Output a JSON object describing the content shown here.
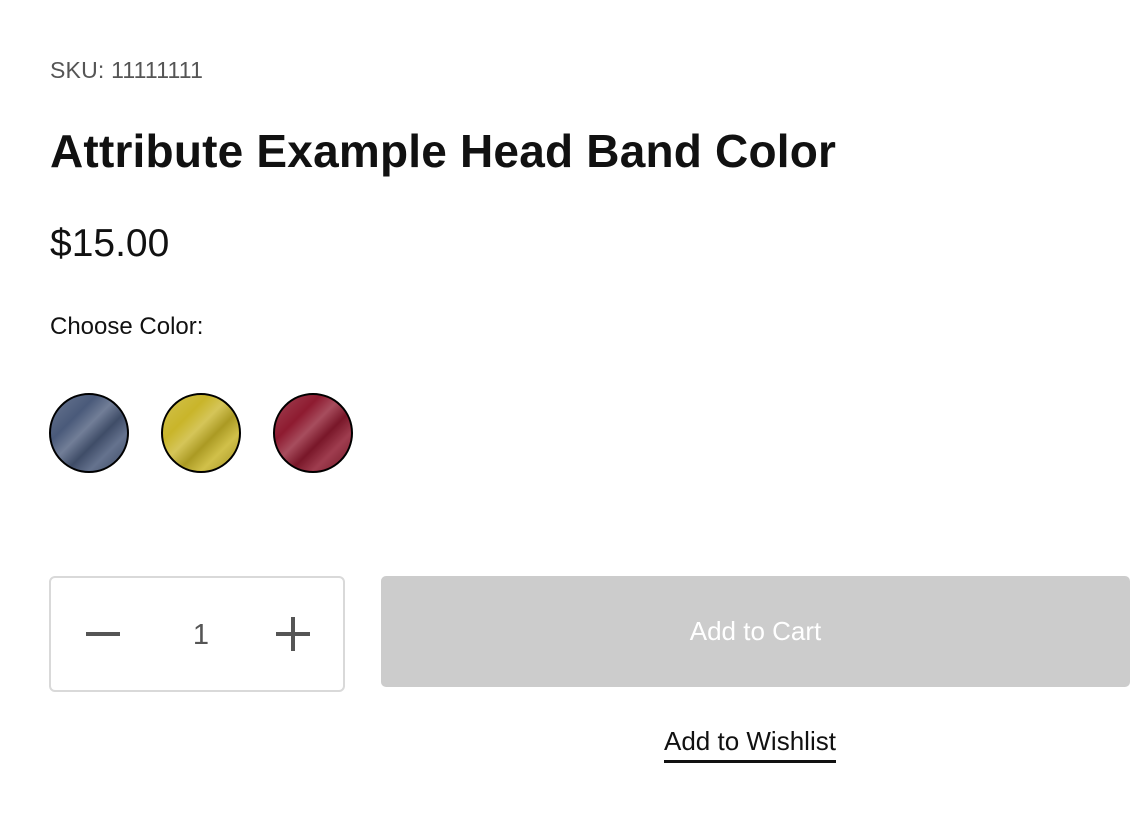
{
  "product": {
    "sku_label": "SKU: 11111111",
    "title": "Attribute Example Head Band Color",
    "price": "$15.00"
  },
  "color_picker": {
    "label": "Choose Color:",
    "swatches": [
      {
        "name": "blue-swatch",
        "color": "#4a5a7a",
        "selected": false
      },
      {
        "name": "yellow-swatch",
        "color": "#c9b52a",
        "selected": false
      },
      {
        "name": "red-swatch",
        "color": "#8e1b30",
        "selected": false
      }
    ]
  },
  "quantity": {
    "value": "1",
    "decrement_icon": "minus-icon",
    "increment_icon": "plus-icon"
  },
  "actions": {
    "add_to_cart_label": "Add to Cart",
    "add_to_cart_disabled": true,
    "add_to_wishlist_label": "Add to Wishlist"
  },
  "colors": {
    "button_disabled_bg": "#cccccc",
    "text_primary": "#111111",
    "text_secondary": "#555555",
    "border_light": "#d9d9d9"
  }
}
